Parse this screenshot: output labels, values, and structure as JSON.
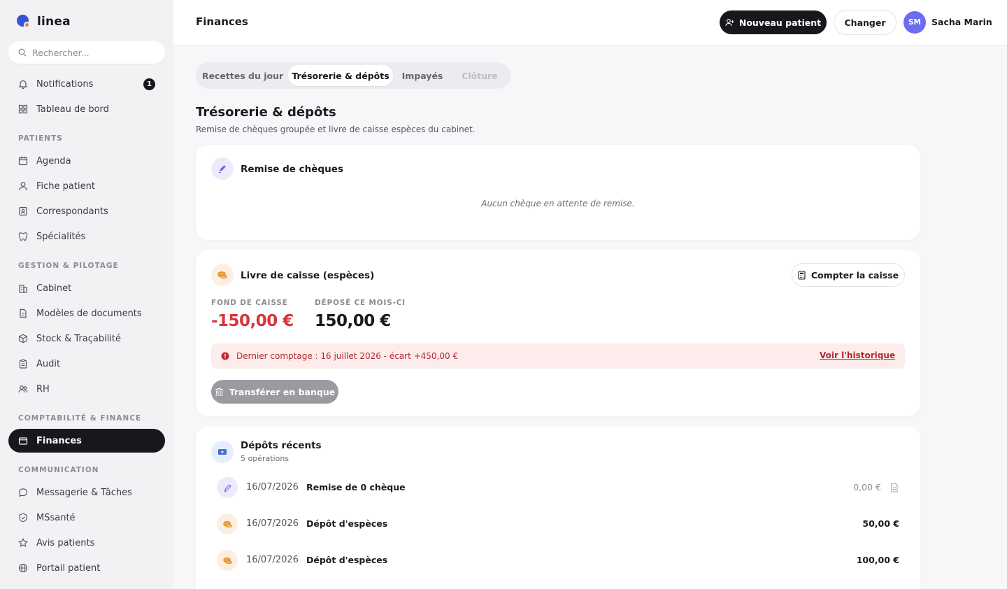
{
  "app": {
    "name": "linea"
  },
  "search": {
    "placeholder": "Rechercher..."
  },
  "sidebar": {
    "top_items": [
      {
        "label": "Notifications",
        "icon": "bell-icon",
        "badge": "1"
      },
      {
        "label": "Tableau de bord",
        "icon": "grid-icon"
      }
    ],
    "sections": [
      {
        "label": "PATIENTS",
        "items": [
          {
            "label": "Agenda",
            "icon": "calendar-icon"
          },
          {
            "label": "Fiche patient",
            "icon": "user-icon"
          },
          {
            "label": "Correspondants",
            "icon": "contact-card-icon"
          },
          {
            "label": "Spécialités",
            "icon": "tooth-icon"
          }
        ]
      },
      {
        "label": "GESTION & PILOTAGE",
        "items": [
          {
            "label": "Cabinet",
            "icon": "building-icon"
          },
          {
            "label": "Modèles de documents",
            "icon": "document-icon"
          },
          {
            "label": "Stock & Traçabilité",
            "icon": "box-icon"
          },
          {
            "label": "Audit",
            "icon": "clipboard-icon"
          },
          {
            "label": "RH",
            "icon": "users-icon"
          }
        ]
      },
      {
        "label": "COMPTABILITÉ & FINANCE",
        "items": [
          {
            "label": "Finances",
            "icon": "wallet-icon",
            "active": true
          }
        ]
      },
      {
        "label": "COMMUNICATION",
        "items": [
          {
            "label": "Messagerie & Tâches",
            "icon": "chat-icon"
          },
          {
            "label": "MSsanté",
            "icon": "shield-icon"
          },
          {
            "label": "Avis patients",
            "icon": "star-icon"
          },
          {
            "label": "Portail patient",
            "icon": "globe-icon"
          }
        ]
      }
    ]
  },
  "header": {
    "title": "Finances",
    "new_patient_label": "Nouveau patient",
    "change_label": "Changer",
    "user_initials": "SM",
    "user_name": "Sacha Marin"
  },
  "tabs": [
    {
      "label": "Recettes du jour",
      "state": "normal"
    },
    {
      "label": "Trésorerie & dépôts",
      "state": "active"
    },
    {
      "label": "Impayés",
      "state": "normal"
    },
    {
      "label": "Clôture",
      "state": "disabled"
    }
  ],
  "main": {
    "title": "Trésorerie & dépôts",
    "subtitle": "Remise de chèques groupée et livre de caisse espèces du cabinet."
  },
  "cheques": {
    "title": "Remise de chèques",
    "empty": "Aucun chèque en attente de remise."
  },
  "cashbook": {
    "title": "Livre de caisse (espèces)",
    "count_label": "Compter la caisse",
    "fund_label": "FOND DE CAISSE",
    "fund_value": "-150,00 €",
    "deposited_label": "DÉPOSÉ CE MOIS-CI",
    "deposited_value": "150,00 €",
    "alert_text": "Dernier comptage : 16 juillet 2026 - écart +450,00 €",
    "alert_link": "Voir l'historique",
    "transfer_label": "Transférer en banque"
  },
  "deposits": {
    "title": "Dépôts récents",
    "subtitle": "5 opérations",
    "rows": [
      {
        "date": "16/07/2026",
        "label": "Remise de 0 chèque",
        "amount": "0,00 €",
        "kind": "cheque"
      },
      {
        "date": "16/07/2026",
        "label": "Dépôt d'espèces",
        "amount": "50,00 €",
        "kind": "cash"
      },
      {
        "date": "16/07/2026",
        "label": "Dépôt d'espèces",
        "amount": "100,00 €",
        "kind": "cash"
      }
    ]
  },
  "colors": {
    "primary": "#18181c",
    "danger": "#d8343a",
    "avatar": "#6c6cf0",
    "cheque_icon": "#7a5af0",
    "cash_icon": "#e08a2e"
  }
}
